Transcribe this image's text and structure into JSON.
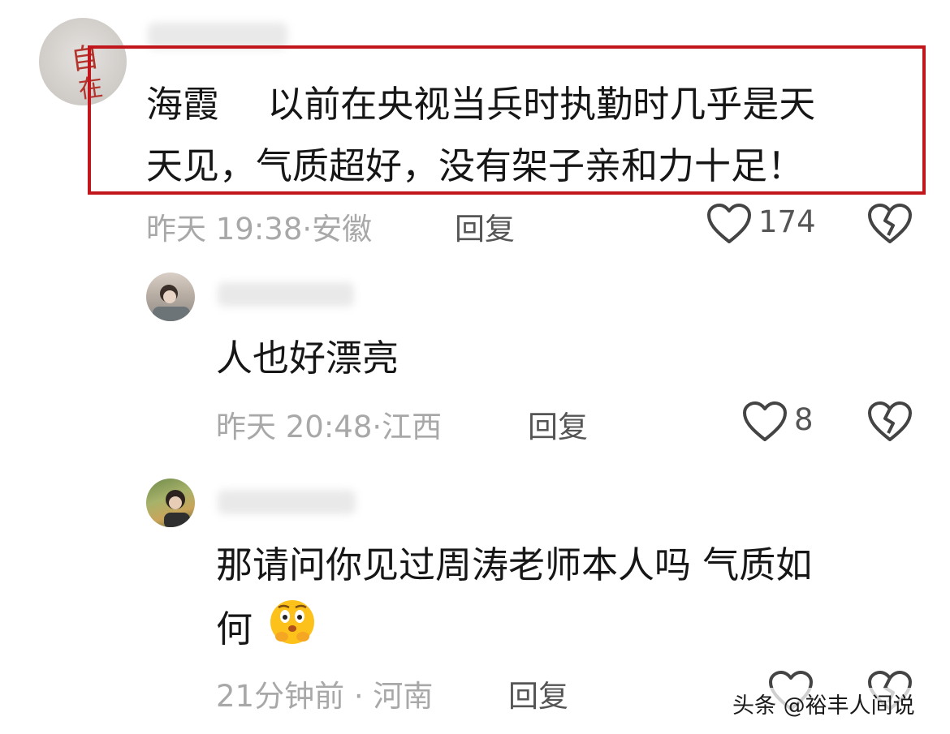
{
  "comments": [
    {
      "content_lines": [
        "海霞　 以前在央视当兵时执勤时几乎是天",
        "天见，气质超好，没有架子亲和力十足！"
      ],
      "time": "昨天 19:38",
      "location": "安徽",
      "reply": "回复",
      "likes": "174"
    },
    {
      "content_lines": [
        "人也好漂亮"
      ],
      "time": "昨天 20:48",
      "location": "江西",
      "reply": "回复",
      "likes": "8"
    },
    {
      "content_lines": [
        "那请问你见过周涛老师本人吗 气质如",
        "何"
      ],
      "time": "21分钟前",
      "location": "河南",
      "reply": "回复",
      "likes": ""
    }
  ],
  "avatar1_text": "自在",
  "meta_sep": "·",
  "watermark": "头条 @裕丰人间说",
  "colors": {
    "highlight": "#c0161c",
    "meta": "#a8a8a8"
  }
}
